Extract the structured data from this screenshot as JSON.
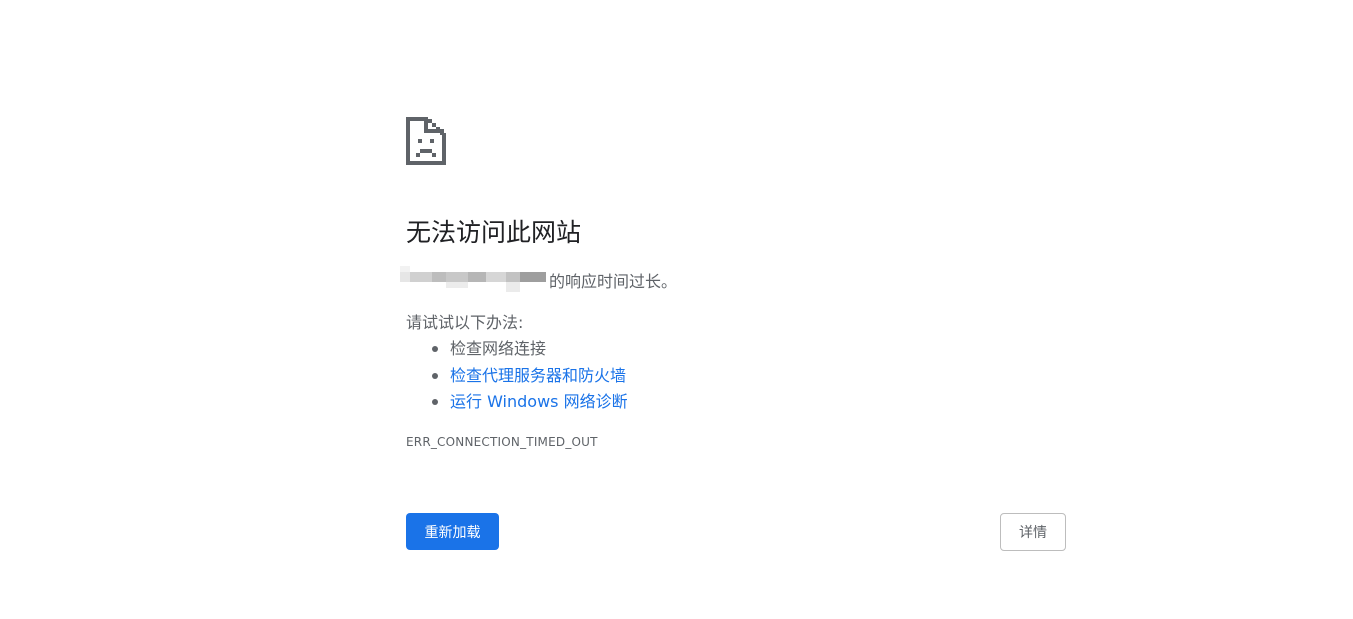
{
  "error": {
    "icon": "sad-file-icon",
    "title": "无法访问此网站",
    "host_suffix": "的响应时间过长。",
    "hint": "请试试以下办法:",
    "suggestions": [
      {
        "label": "检查网络连接",
        "link": false
      },
      {
        "label": "检查代理服务器和防火墙",
        "link": true
      },
      {
        "label": "运行 Windows 网络诊断",
        "link": true
      }
    ],
    "code": "ERR_CONNECTION_TIMED_OUT"
  },
  "buttons": {
    "reload_label": "重新加载",
    "details_label": "详情"
  },
  "colors": {
    "accent": "#1a73e8",
    "text_secondary": "#5f6368",
    "text_primary": "#202124"
  }
}
